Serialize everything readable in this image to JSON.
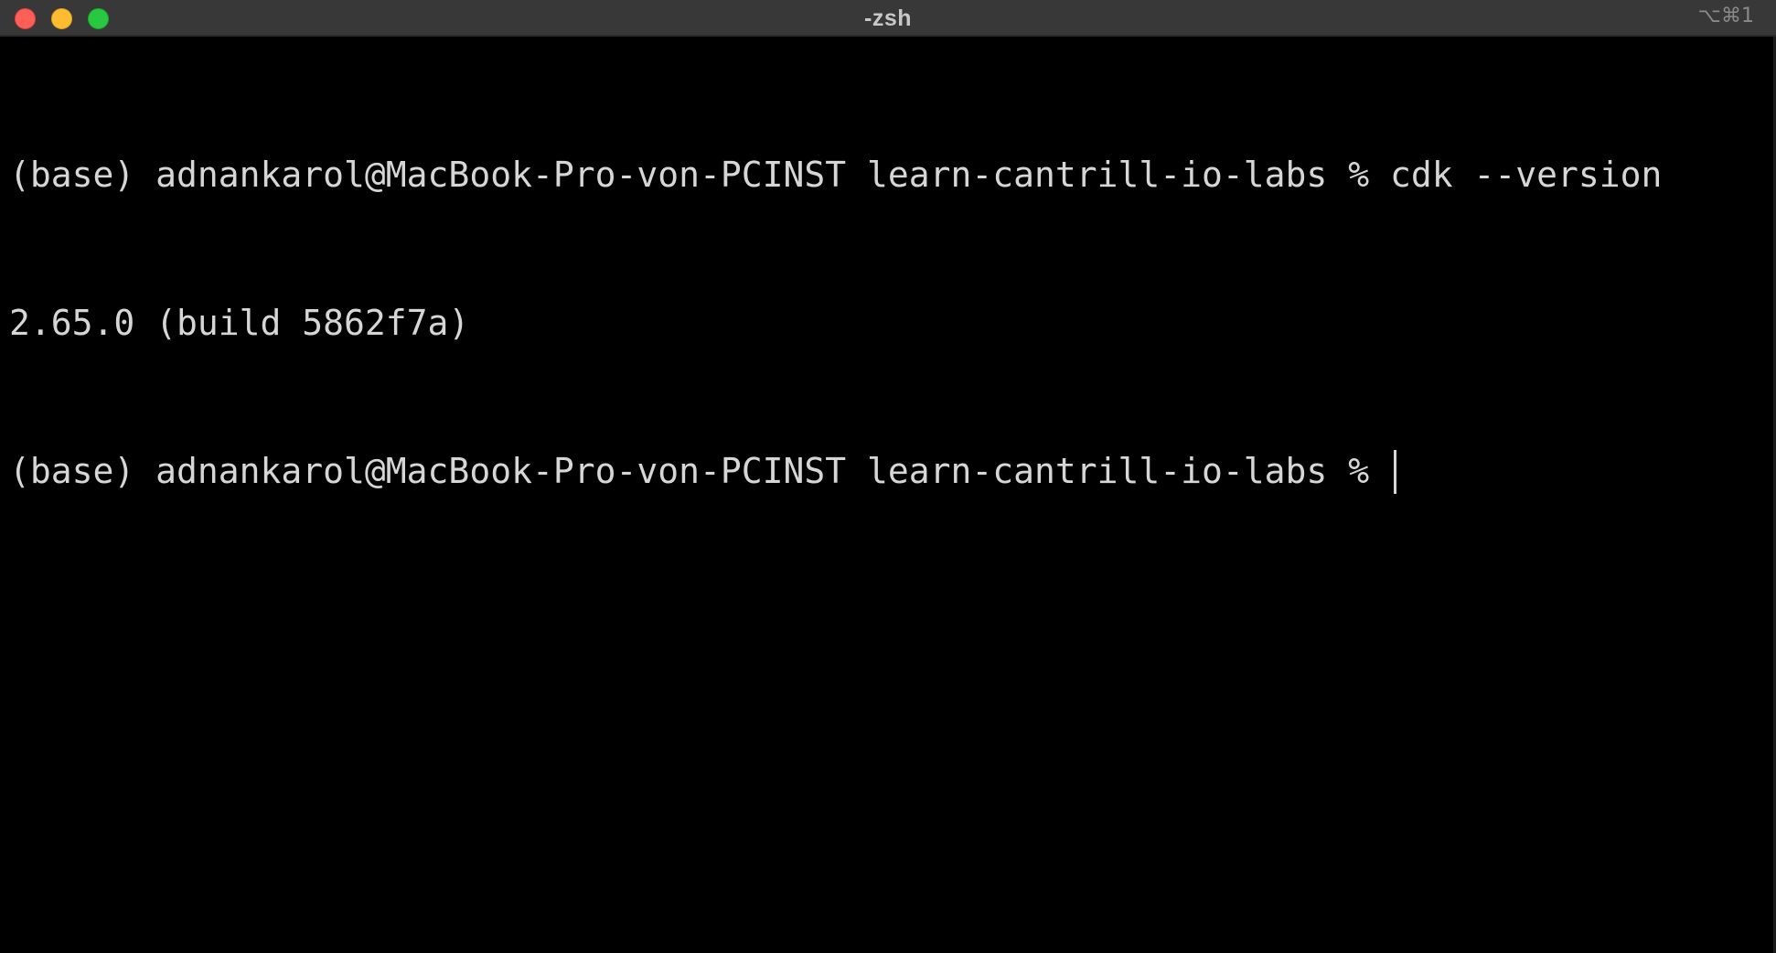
{
  "window": {
    "title": "-zsh",
    "shortcut": "⌥⌘1"
  },
  "terminal": {
    "lines": [
      "(base) adnankarol@MacBook-Pro-von-PCINST learn-cantrill-io-labs % cdk --version",
      "2.65.0 (build 5862f7a)",
      "(base) adnankarol@MacBook-Pro-von-PCINST learn-cantrill-io-labs % "
    ]
  },
  "colors": {
    "background": "#000000",
    "text": "#d6d6d6",
    "titlebar": "#383838",
    "close": "#ff5f57",
    "minimize": "#febc2e",
    "zoom": "#28c840"
  }
}
